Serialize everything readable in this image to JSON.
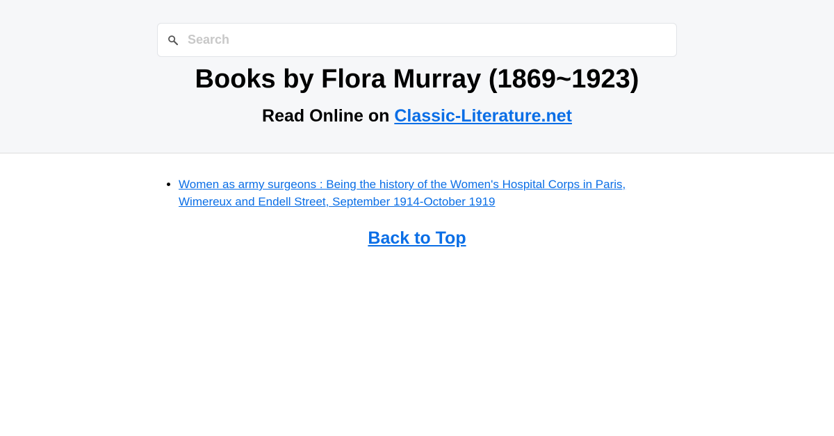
{
  "search": {
    "placeholder": "Search",
    "icon": "search-icon"
  },
  "header": {
    "title": "Books by Flora Murray (1869~1923)",
    "subtitle_prefix": "Read Online on ",
    "site_link_label": "Classic-Literature.net"
  },
  "books": [
    {
      "title": "Women as army surgeons : Being the history of the Women's Hospital Corps in Paris, Wimereux and Endell Street, September 1914-October 1919"
    }
  ],
  "footer": {
    "back_to_top_label": "Back to Top"
  },
  "colors": {
    "link": "#0a6ee6",
    "header_bg": "#f6f7f9"
  }
}
